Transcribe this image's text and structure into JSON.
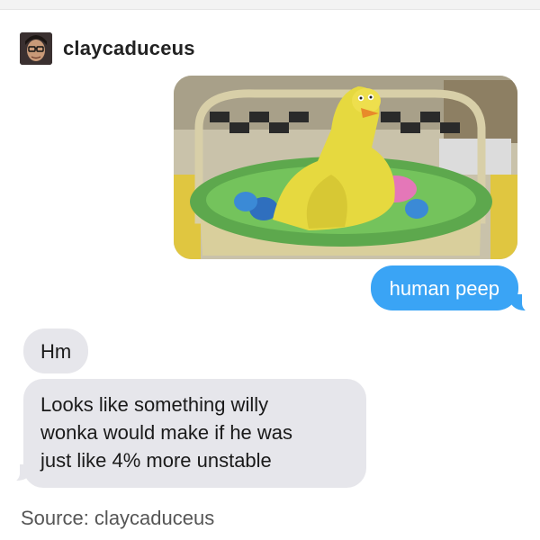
{
  "post": {
    "username": "claycaduceus",
    "avatar_icon": "user-avatar-icon",
    "photo_icon": "big-bird-easter-basket-photo"
  },
  "messages": {
    "sent": [
      "human peep"
    ],
    "received": {
      "first": "Hm",
      "second_lines": [
        "Looks like something willy",
        "wonka would make if he was",
        "just like 4% more unstable"
      ]
    }
  },
  "footer": {
    "source": "Source: claycaduceus"
  },
  "colors": {
    "sent_bubble": "#3aa4f5",
    "received_bubble": "#e6e6eb",
    "text_dark": "#1a1a1a",
    "source_text": "#555555"
  }
}
